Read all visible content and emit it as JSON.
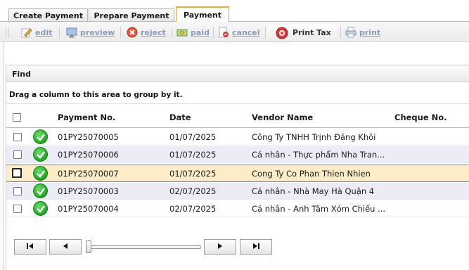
{
  "tabs": [
    {
      "label": "Create Payment"
    },
    {
      "label": "Prepare Payment"
    },
    {
      "label": "Payment"
    }
  ],
  "toolbar": {
    "edit": "edit",
    "preview": "preview",
    "reject": "reject",
    "paid": "paid",
    "cancel": "cancel",
    "print_tax": "Print Tax",
    "print": "print"
  },
  "grid": {
    "find_label": "Find",
    "group_hint": "Drag a column to this area to group by it.",
    "columns": {
      "payment_no": "Payment No.",
      "date": "Date",
      "vendor": "Vendor Name",
      "cheque": "Cheque No."
    },
    "rows": [
      {
        "payment_no": "01PY25070005",
        "date": "01/07/2025",
        "vendor": "Công Ty TNHH Trịnh Đăng Khôi",
        "cheque": ""
      },
      {
        "payment_no": "01PY25070006",
        "date": "01/07/2025",
        "vendor": "Cá nhân - Thực phẩm Nha Tran...",
        "cheque": ""
      },
      {
        "payment_no": "01PY25070007",
        "date": "01/07/2025",
        "vendor": "Cong Ty Co Phan Thien Nhien",
        "cheque": ""
      },
      {
        "payment_no": "01PY25070003",
        "date": "02/07/2025",
        "vendor": "Cá nhân - Nhà May Hà Quận 4",
        "cheque": ""
      },
      {
        "payment_no": "01PY25070004",
        "date": "02/07/2025",
        "vendor": "Cá nhân - Anh Tâm Xóm Chiếu ...",
        "cheque": ""
      }
    ],
    "selected_row": 3
  },
  "pager": {
    "first": "first-page-icon",
    "prev": "prev-page-icon",
    "next": "next-page-icon",
    "last": "last-page-icon"
  },
  "colors": {
    "accent_tab": "#f0ad3c",
    "selected_row": "#fdecc8",
    "alt_row": "#ececf7",
    "status_ok": "#23a423"
  }
}
